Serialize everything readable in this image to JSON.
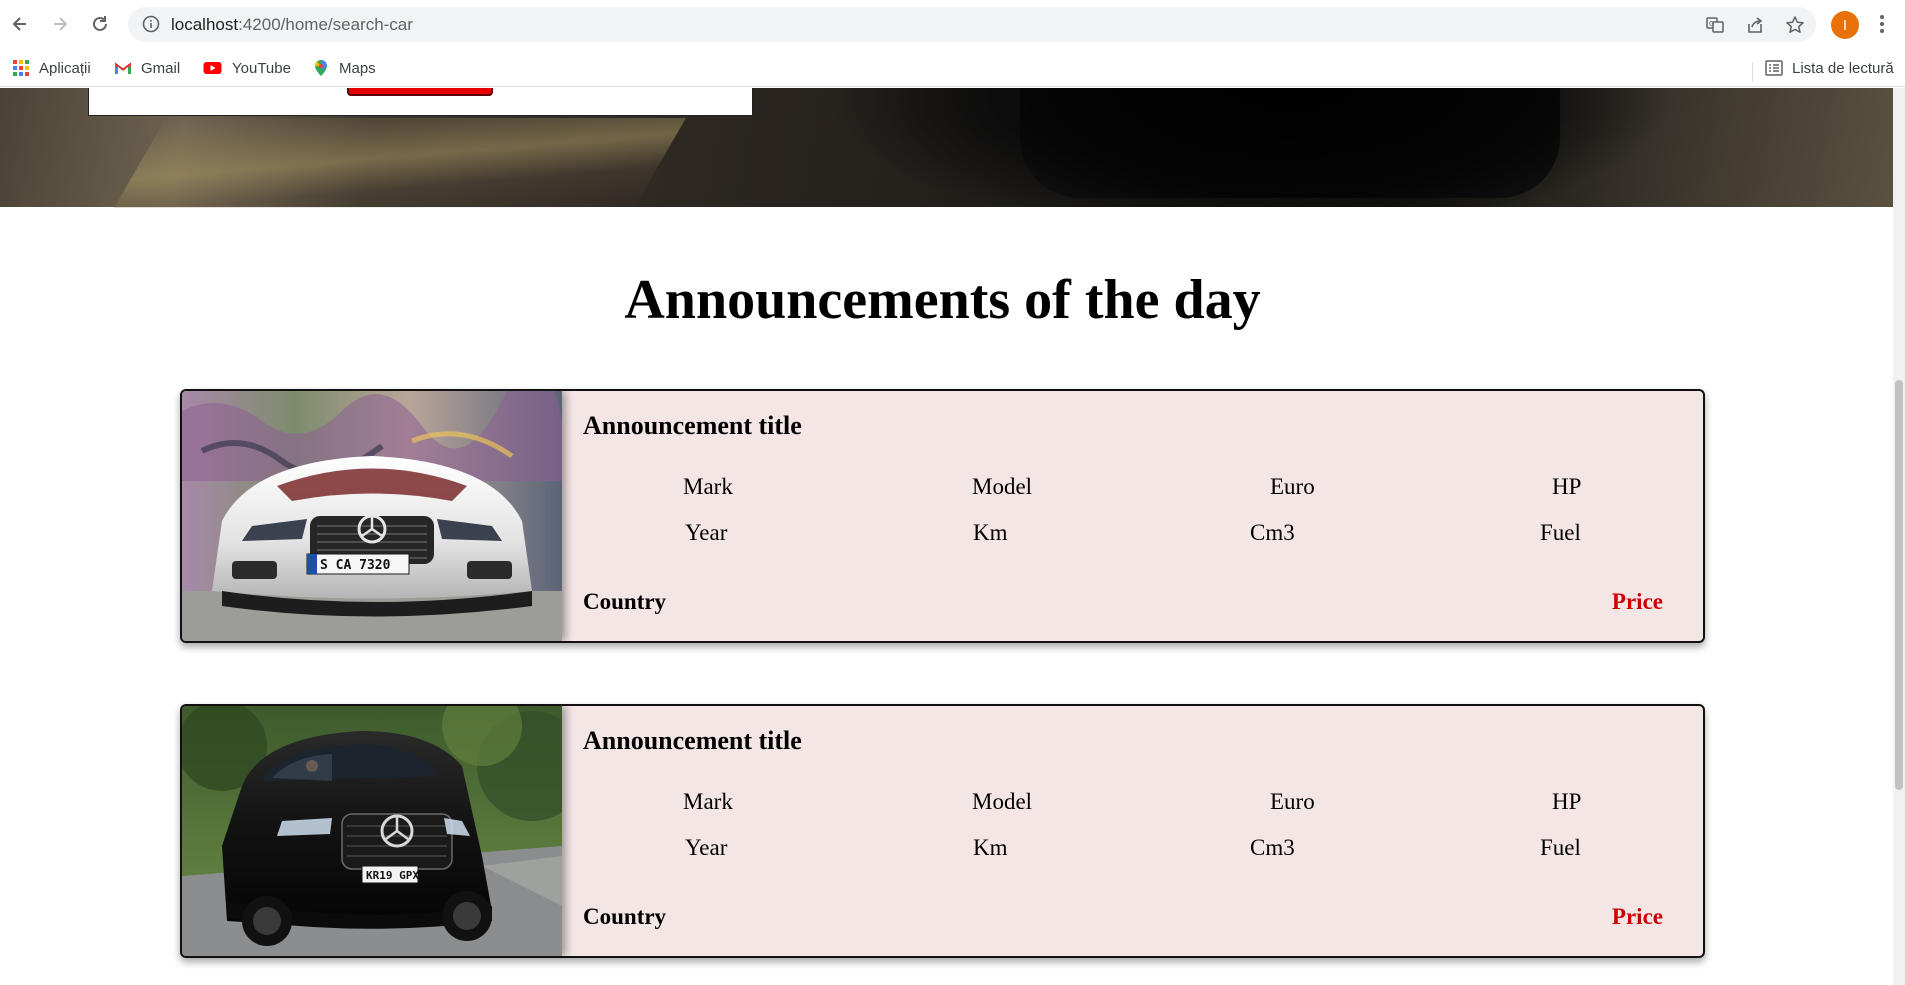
{
  "browser": {
    "url_host": "localhost",
    "url_path": ":4200/home/search-car",
    "profile_initial": "I",
    "bookmarks": [
      {
        "label": "Aplicații",
        "icon": "apps-grid-icon"
      },
      {
        "label": "Gmail",
        "icon": "gmail-icon"
      },
      {
        "label": "YouTube",
        "icon": "youtube-icon"
      },
      {
        "label": "Maps",
        "icon": "maps-icon"
      }
    ],
    "reading_list": "Lista de lectură"
  },
  "page": {
    "section_title": "Announcements of the day",
    "cards": [
      {
        "image": "white-mercedes-convertible",
        "title": "Announcement title",
        "row1": [
          "Mark",
          "Model",
          "Euro",
          "HP"
        ],
        "row2": [
          "Year",
          "Km",
          "Cm3",
          "Fuel"
        ],
        "country": "Country",
        "price": "Price"
      },
      {
        "image": "black-mercedes-suv",
        "title": "Announcement title",
        "row1": [
          "Mark",
          "Model",
          "Euro",
          "HP"
        ],
        "row2": [
          "Year",
          "Km",
          "Cm3",
          "Fuel"
        ],
        "country": "Country",
        "price": "Price"
      }
    ]
  },
  "colors": {
    "card_background": "#f5e6e6",
    "price": "#cc0000",
    "search_button": "#e60000"
  }
}
